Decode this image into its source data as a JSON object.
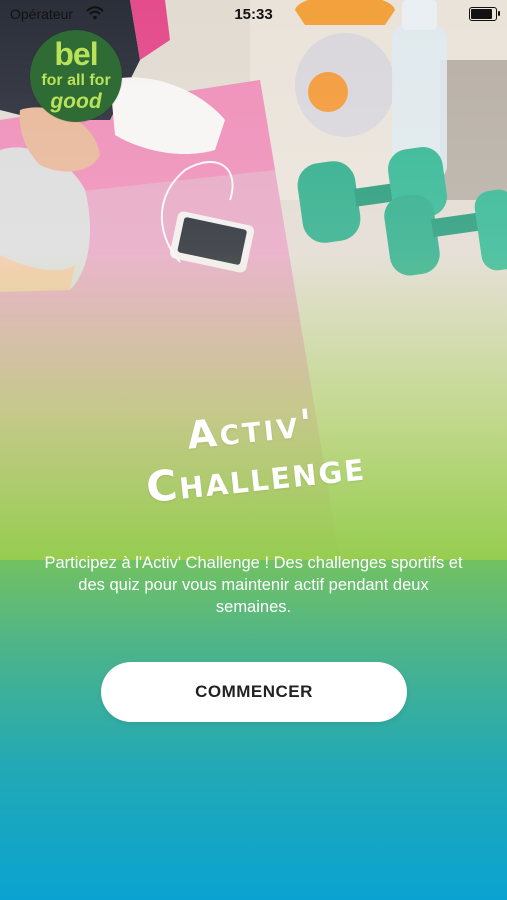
{
  "status_bar": {
    "carrier": "Opérateur",
    "time": "15:33",
    "battery_level": 0.95,
    "icons": [
      "wifi-icon",
      "battery-icon"
    ]
  },
  "logo": {
    "line1": "bel",
    "line2": "for all for",
    "line3": "good",
    "colors": {
      "background": "#2f6b35",
      "text": "#b9e25a"
    }
  },
  "hero": {
    "title_line1": "Activ'",
    "title_line2": "Challenge",
    "description": "Participez à l'Activ' Challenge ! Des challenges sportifs et des quiz pour vous maintenir actif pendant deux semaines."
  },
  "actions": {
    "start_label": "COMMENCER"
  },
  "colors": {
    "gradient_green": "#86c94c",
    "gradient_blue": "#0aa3d1",
    "button_bg": "#ffffff"
  }
}
